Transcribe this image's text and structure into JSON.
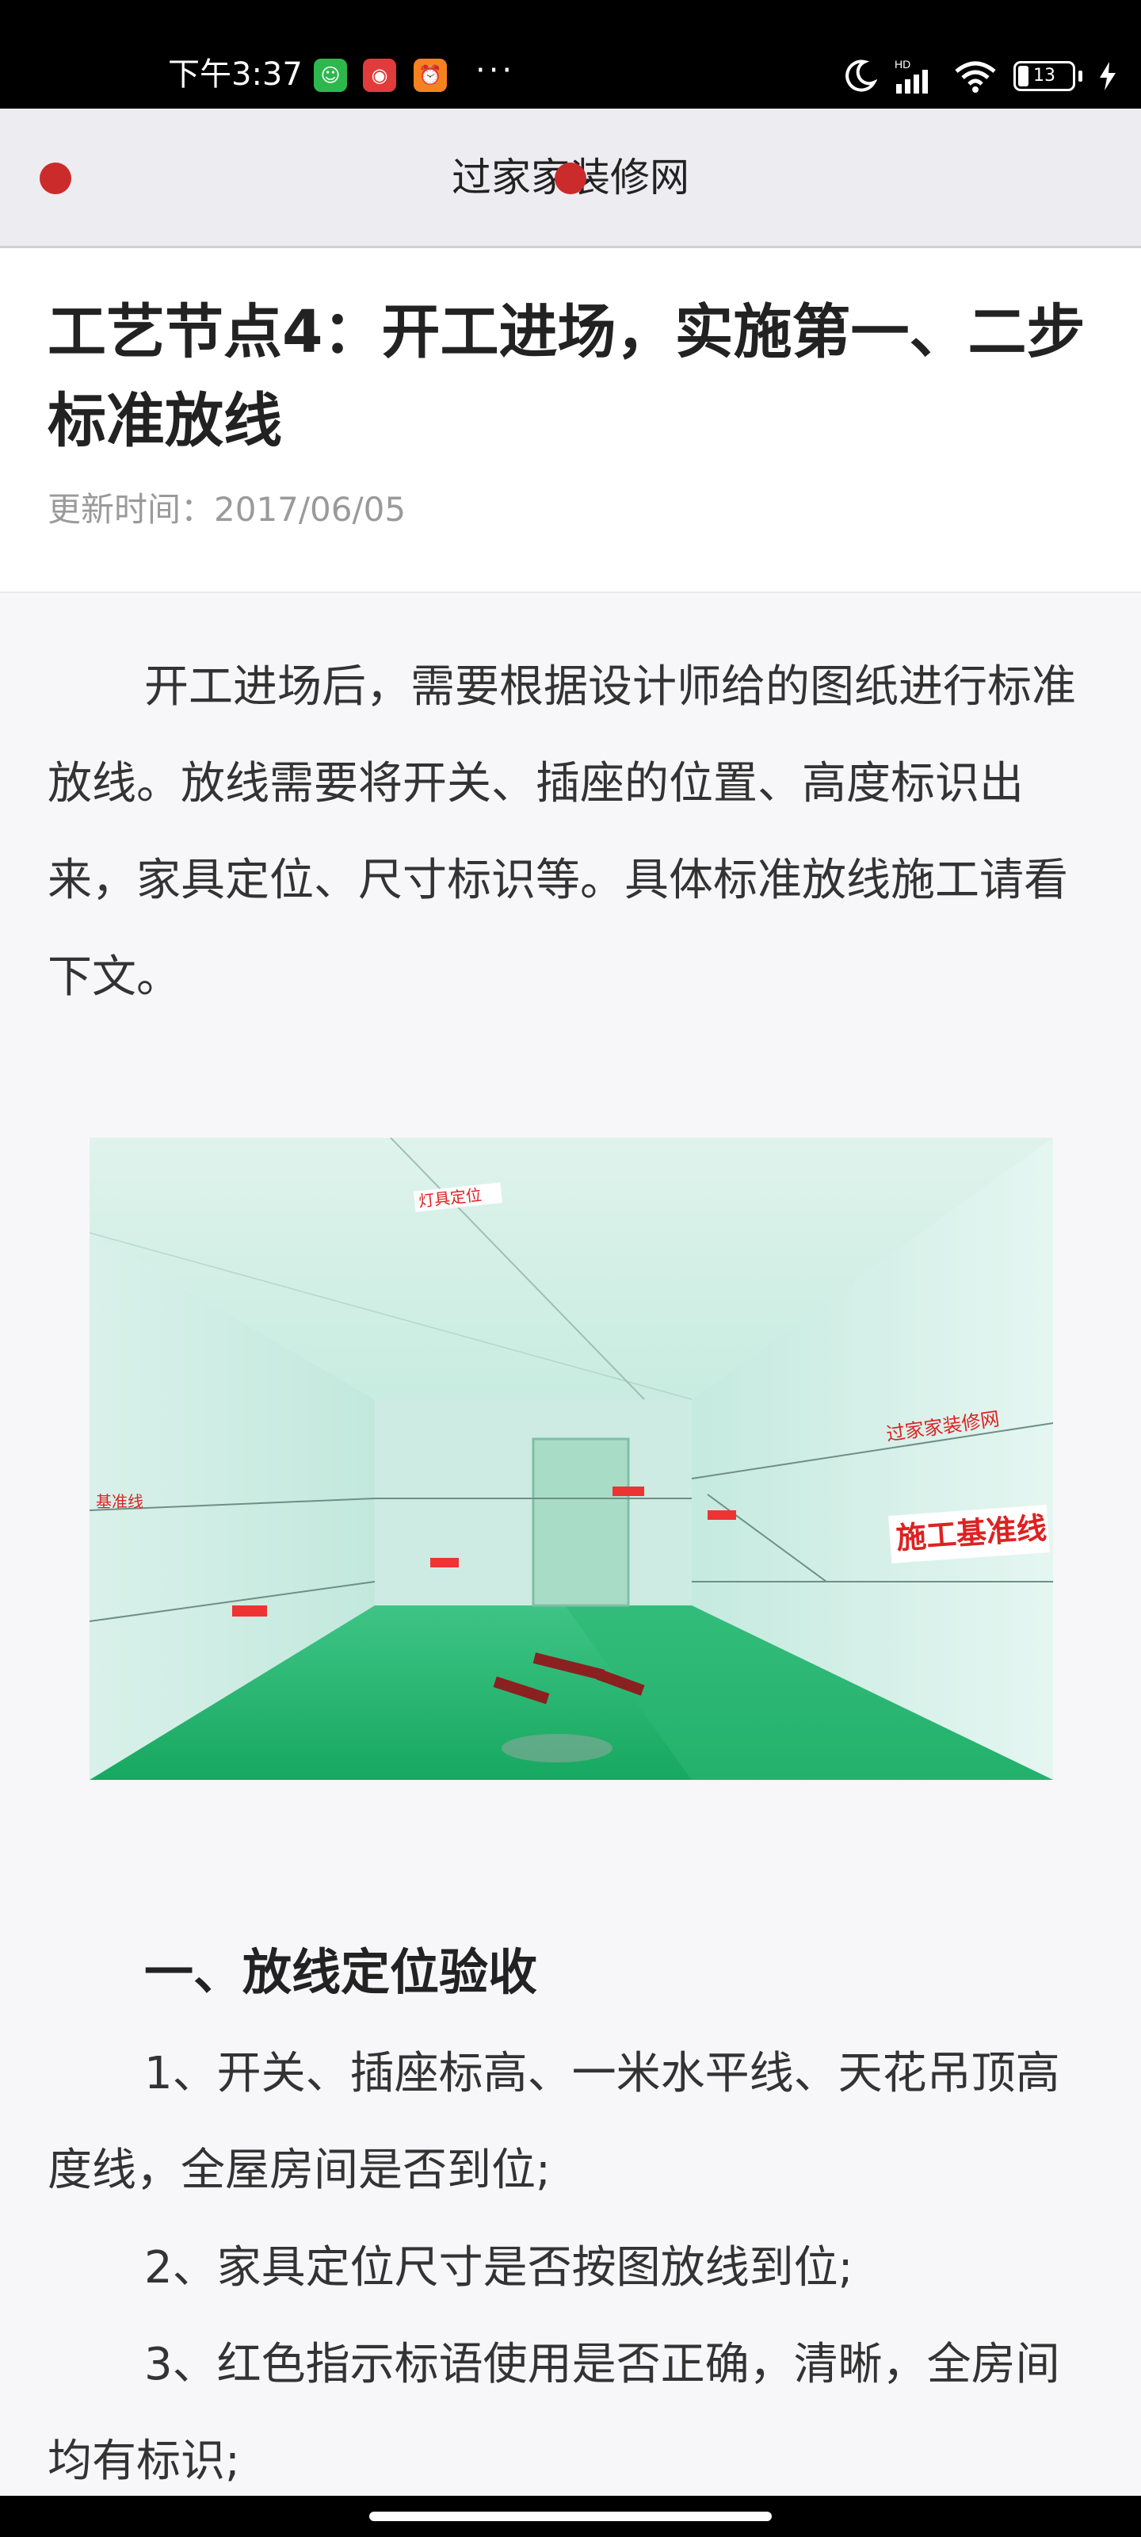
{
  "status_bar": {
    "time": "下午3:37",
    "app_icons": [
      "wechat-icon",
      "app-red-icon",
      "alarm-icon"
    ],
    "more": "···",
    "network": "HD",
    "battery": "13"
  },
  "header": {
    "title": "过家家装修网"
  },
  "article": {
    "title": "工艺节点4：开工进场，实施第一、二步标准放线",
    "date": "更新时间：2017/06/05",
    "intro": "开工进场后，需要根据设计师给的图纸进行标准放线。放线需要将开关、插座的位置、高度标识出来，家具定位、尺寸标识等。具体标准放线施工请看下文。",
    "image": {
      "alt_labels": [
        "灯具定位",
        "过家家装修网",
        "施工基准线",
        "基准线"
      ]
    },
    "section_heading": "一、放线定位验收",
    "items": [
      "1、开关、插座标高、一米水平线、天花吊顶高度线，全屋房间是否到位;",
      "2、家具定位尺寸是否按图放线到位;",
      "3、红色指示标语使用是否正确，清晰，全房间均有标识;"
    ]
  },
  "colors": {
    "accent_dot": "#cc2b2b",
    "header_bg": "#ededf1",
    "date_text": "#9a9a9a"
  }
}
